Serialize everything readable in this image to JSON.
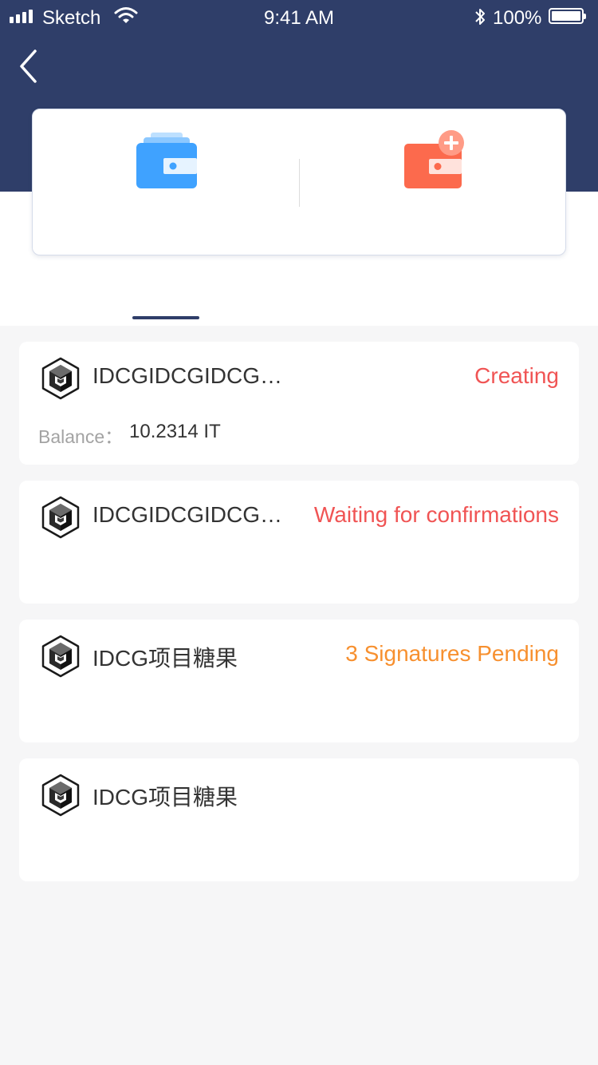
{
  "status_bar": {
    "carrier": "Sketch",
    "time": "9:41 AM",
    "battery": "100%"
  },
  "header": {
    "back_icon": "chevron-left-icon"
  },
  "actions": {
    "left_icon": "wallet-icon",
    "right_icon": "wallet-add-icon",
    "colors": {
      "left": "#3fa2ff",
      "right": "#fc6a4d"
    }
  },
  "colors": {
    "header_bg": "#2f3e69",
    "status_red": "#f05454",
    "status_orange": "#f7902f"
  },
  "wallets": [
    {
      "name": "IDCGIDCGIDCGIDCGIDCG",
      "status": "Creating",
      "status_color": "#f05454",
      "balance_label": "Balance：",
      "balance": "10.2314 IT"
    },
    {
      "name": "IDCGIDCGIDCGIDCGIDCG",
      "status": "Waiting for confirmations",
      "status_color": "#f05454"
    },
    {
      "name": "IDCG项目糖果",
      "status": "3 Signatures Pending",
      "status_color": "#f7902f"
    },
    {
      "name": "IDCG项目糖果",
      "status": ""
    }
  ]
}
